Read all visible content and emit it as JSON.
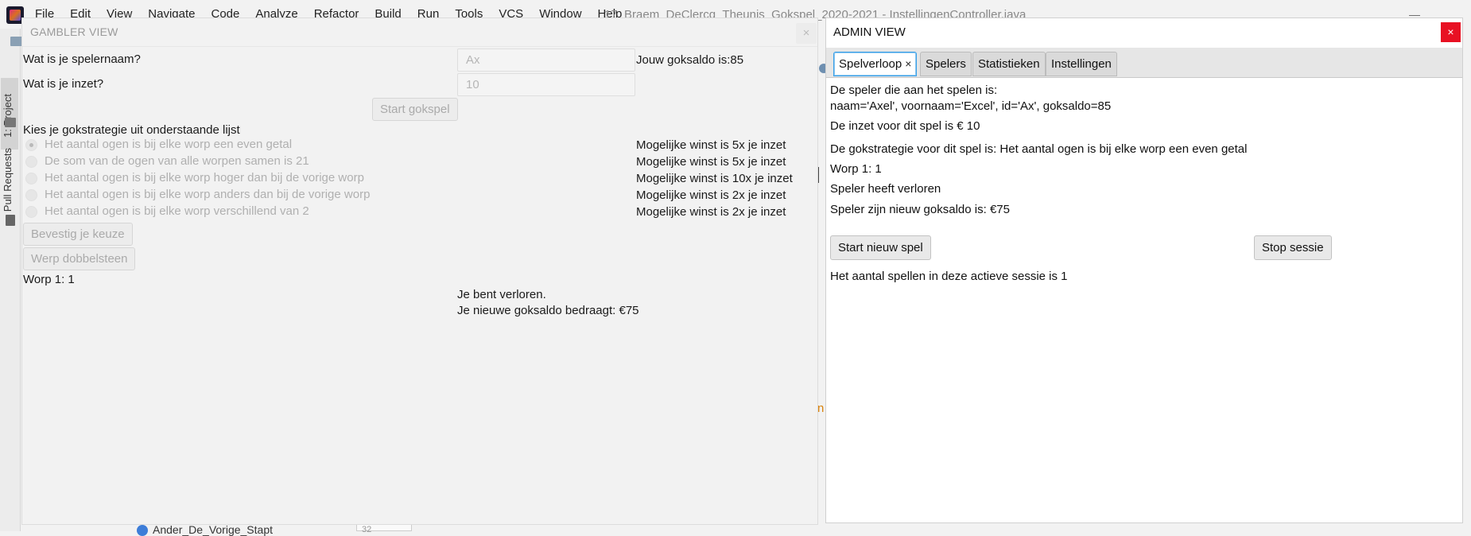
{
  "ide": {
    "menu": [
      "File",
      "Edit",
      "View",
      "Navigate",
      "Code",
      "Analyze",
      "Refactor",
      "Build",
      "Run",
      "Tools",
      "VCS",
      "Window",
      "Help"
    ],
    "title": "17_Braem_DeClercq_Theunis_Gokspel_2020-2021 - InstellingenController.java",
    "side_tabs": {
      "project": "1: Project",
      "pull_requests": "Pull Requests"
    },
    "bottom_item": "Ander_De_Vorige_Stapt",
    "bottom_box_text": "32"
  },
  "gambler": {
    "title": "GAMBLER VIEW",
    "close_glyph": "×",
    "name_label": "Wat is je spelernaam?",
    "name_value": "Ax",
    "bet_label": "Wat is je inzet?",
    "bet_value": "10",
    "balance_text": "Jouw goksaldo is:85",
    "start_button": "Start gokspel",
    "strategy_label": "Kies je gokstrategie uit onderstaande lijst",
    "strategies": [
      {
        "label": "Het aantal ogen is bij elke worp een even getal",
        "win": "Mogelijke winst is 5x je inzet",
        "selected": true
      },
      {
        "label": "De som van de ogen van alle worpen samen is 21",
        "win": "Mogelijke winst is 5x je inzet",
        "selected": false
      },
      {
        "label": "Het aantal ogen is bij elke worp hoger dan bij de vorige worp",
        "win": "Mogelijke winst is 10x je inzet",
        "selected": false
      },
      {
        "label": "Het aantal ogen is bij elke worp anders dan bij de vorige worp",
        "win": "Mogelijke winst is 2x je inzet",
        "selected": false
      },
      {
        "label": "Het aantal ogen is bij elke worp verschillend van 2",
        "win": "Mogelijke winst is 2x je inzet",
        "selected": false
      }
    ],
    "confirm_button": "Bevestig je keuze",
    "roll_button": "Werp dobbelsteen",
    "roll_result": "Worp 1: 1",
    "lost_text": "Je bent verloren.",
    "new_balance_text": "Je nieuwe goksaldo bedraagt: €75"
  },
  "admin": {
    "title": "ADMIN VIEW",
    "close_glyph": "×",
    "tabs": [
      {
        "label": "Spelverloop",
        "close": "×",
        "active": true
      },
      {
        "label": "Spelers",
        "active": false
      },
      {
        "label": "Statistieken",
        "active": false
      },
      {
        "label": "Instellingen",
        "active": false
      }
    ],
    "player_heading": "De speler die aan het spelen is:",
    "player_info": "naam='Axel', voornaam='Excel', id='Ax', goksaldo=85",
    "bet_info": "De inzet voor dit spel is € 10",
    "strategy_info": "De gokstrategie voor dit spel is: Het aantal ogen is bij elke worp een even getal",
    "roll_info": "Worp 1: 1",
    "result_info": "Speler heeft verloren",
    "new_balance_info": "Speler zijn nieuw goksaldo is: €75",
    "new_game_button": "Start nieuw spel",
    "stop_button": "Stop sessie",
    "session_info": "Het aantal spellen in deze actieve sessie is 1"
  },
  "colors": {
    "accent_tab_border": "#39a0e8",
    "close_red": "#e81123",
    "disabled_text": "#b0b0b0"
  }
}
